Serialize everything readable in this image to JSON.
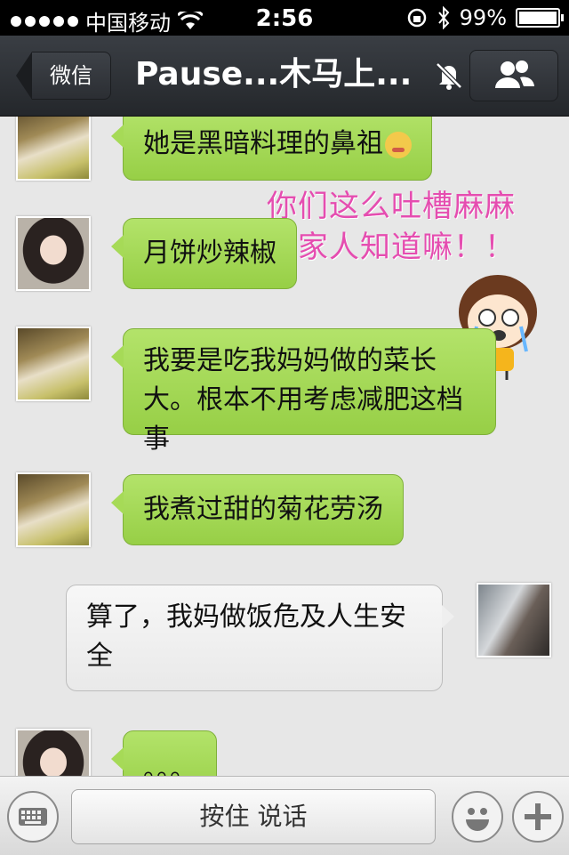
{
  "status_bar": {
    "carrier": "中国移动",
    "time": "2:56",
    "battery": "99%"
  },
  "nav": {
    "back_label": "微信",
    "title": "Pause...木马上..."
  },
  "messages": [
    {
      "side": "left",
      "text": "她是黑暗料理的鼻祖"
    },
    {
      "side": "left",
      "text": "月饼炒辣椒"
    },
    {
      "side": "left",
      "text": "我要是吃我妈妈做的菜长大。根本不用考虑减肥这档事"
    },
    {
      "side": "left",
      "text": "我煮过甜的菊花劳汤"
    },
    {
      "side": "right",
      "text": "算了，我妈做饭危及人生安全"
    },
    {
      "side": "left",
      "text": "。。。"
    }
  ],
  "sticker": {
    "line1": "你们这么吐槽麻麻",
    "line2": "你家人知道嘛！！"
  },
  "input_bar": {
    "hold_to_talk": "按住 说话"
  }
}
